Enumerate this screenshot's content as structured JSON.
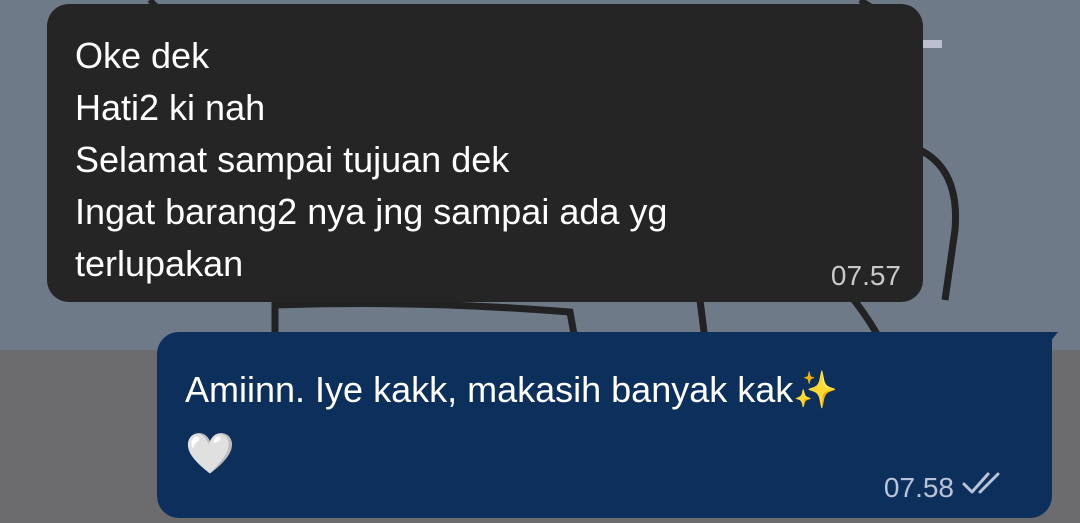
{
  "incoming_message": {
    "lines": [
      "Oke dek",
      "Hati2 ki nah",
      "Selamat sampai tujuan dek",
      "Ingat barang2 nya jng sampai ada yg",
      "terlupakan"
    ],
    "time": "07.57"
  },
  "outgoing_message": {
    "text": "Amiinn. Iye kakk, makasih banyak kak✨",
    "emoji": "🤍",
    "time": "07.58",
    "status_icon": "double-check-icon"
  },
  "colors": {
    "incoming_bubble": "#252525",
    "outgoing_bubble": "#0d2f5c",
    "background": "#6f7a89"
  }
}
